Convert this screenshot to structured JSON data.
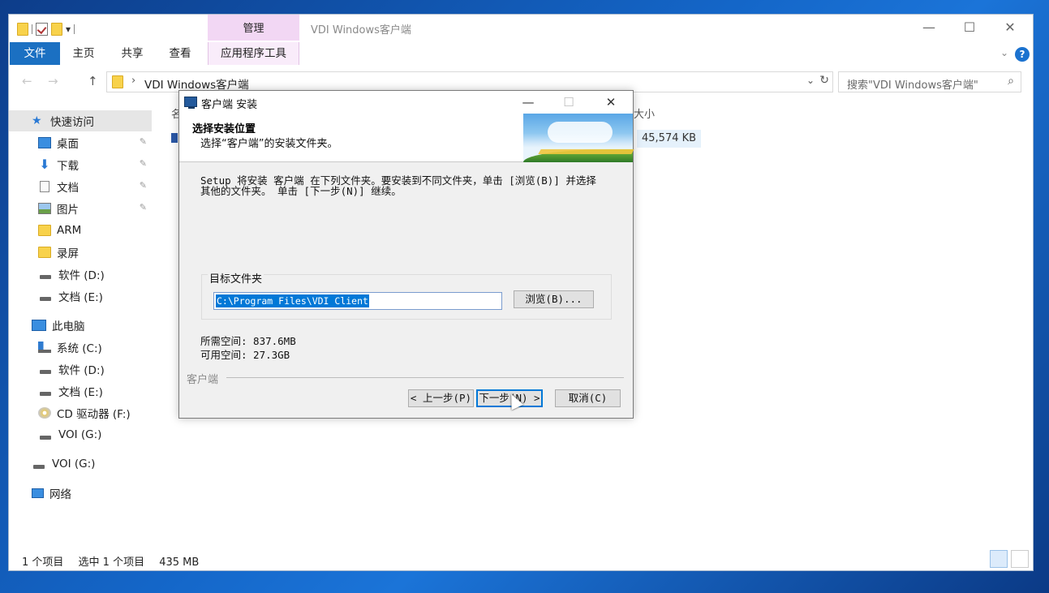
{
  "window": {
    "title": "VDI Windows客户端",
    "context_tab_header": "管理",
    "qat_dropdown": "▾",
    "controls": {
      "minimize": "—",
      "maximize": "☐",
      "close": "✕"
    }
  },
  "ribbon": {
    "tabs": [
      {
        "label": "文件"
      },
      {
        "label": "主页"
      },
      {
        "label": "共享"
      },
      {
        "label": "查看"
      },
      {
        "label": "应用程序工具"
      }
    ],
    "collapse_glyph": "⌄",
    "help_glyph": "?"
  },
  "address": {
    "back": "←",
    "forward": "→",
    "up": "↑",
    "separator": "›",
    "path": "VDI Windows客户端",
    "dropdown": "⌄",
    "refresh": "↻",
    "search_placeholder": "搜索\"VDI Windows客户端\"",
    "search_icon": "⌕"
  },
  "nav": {
    "items": [
      {
        "label": "快速访问",
        "icon": "star-icon",
        "pinned": false,
        "level": 0,
        "selected": true
      },
      {
        "label": "桌面",
        "icon": "desktop-icon",
        "pinned": true,
        "level": 1
      },
      {
        "label": "下载",
        "icon": "download-icon",
        "pinned": true,
        "level": 1
      },
      {
        "label": "文档",
        "icon": "document-icon",
        "pinned": true,
        "level": 1
      },
      {
        "label": "图片",
        "icon": "picture-icon",
        "pinned": true,
        "level": 1
      },
      {
        "label": "ARM",
        "icon": "folder-icon",
        "pinned": false,
        "level": 1
      },
      {
        "label": "录屏",
        "icon": "folder-icon",
        "pinned": false,
        "level": 1
      },
      {
        "label": "软件 (D:)",
        "icon": "drive-icon",
        "pinned": false,
        "level": 1
      },
      {
        "label": "文档 (E:)",
        "icon": "drive-icon",
        "pinned": false,
        "level": 1
      },
      {
        "label": "此电脑",
        "icon": "computer-icon",
        "pinned": false,
        "level": 0
      },
      {
        "label": "系统 (C:)",
        "icon": "system-drive-icon",
        "pinned": false,
        "level": 1
      },
      {
        "label": "软件 (D:)",
        "icon": "drive-icon",
        "pinned": false,
        "level": 1
      },
      {
        "label": "文档 (E:)",
        "icon": "drive-icon",
        "pinned": false,
        "level": 1
      },
      {
        "label": "CD 驱动器 (F:)",
        "icon": "cd-drive-icon",
        "pinned": false,
        "level": 1
      },
      {
        "label": "VOI (G:)",
        "icon": "drive-icon",
        "pinned": false,
        "level": 1
      },
      {
        "label": "VOI (G:)",
        "icon": "drive-icon",
        "pinned": false,
        "level": 0
      },
      {
        "label": "网络",
        "icon": "network-icon",
        "pinned": false,
        "level": 0
      }
    ],
    "pin_glyph": "📌"
  },
  "files": {
    "col_name_partial": "名",
    "col_size_partial": "大小",
    "size_partial": "45,574 KB"
  },
  "status": {
    "count": "1 个项目",
    "selected": "选中 1 个项目",
    "size": "435 MB"
  },
  "dialog": {
    "title": "客户端 安装",
    "heading": "选择安装位置",
    "subheading": "选择“客户端”的安装文件夹。",
    "description_line1": "Setup 将安装 客户端 在下列文件夹。要安装到不同文件夹，单击 [浏览(B)] 并选择",
    "description_line2": "其他的文件夹。 单击 [下一步(N)] 继续。",
    "group_label": "目标文件夹",
    "path_value": "C:\\Program Files\\VDI Client",
    "browse_label": "浏览(B)...",
    "space_required": "所需空间: 837.6MB",
    "space_available": "可用空间: 27.3GB",
    "brand": "客户端",
    "back_label": "< 上一步(P)",
    "next_label": "下一步(N) >",
    "cancel_label": "取消(C)",
    "controls": {
      "minimize": "—",
      "maximize": "☐",
      "close": "✕"
    }
  },
  "colors": {
    "accent": "#1b70c2",
    "context_tab": "#f2d7f4",
    "selection": "#0078d7",
    "desktop": "#1466c8"
  }
}
